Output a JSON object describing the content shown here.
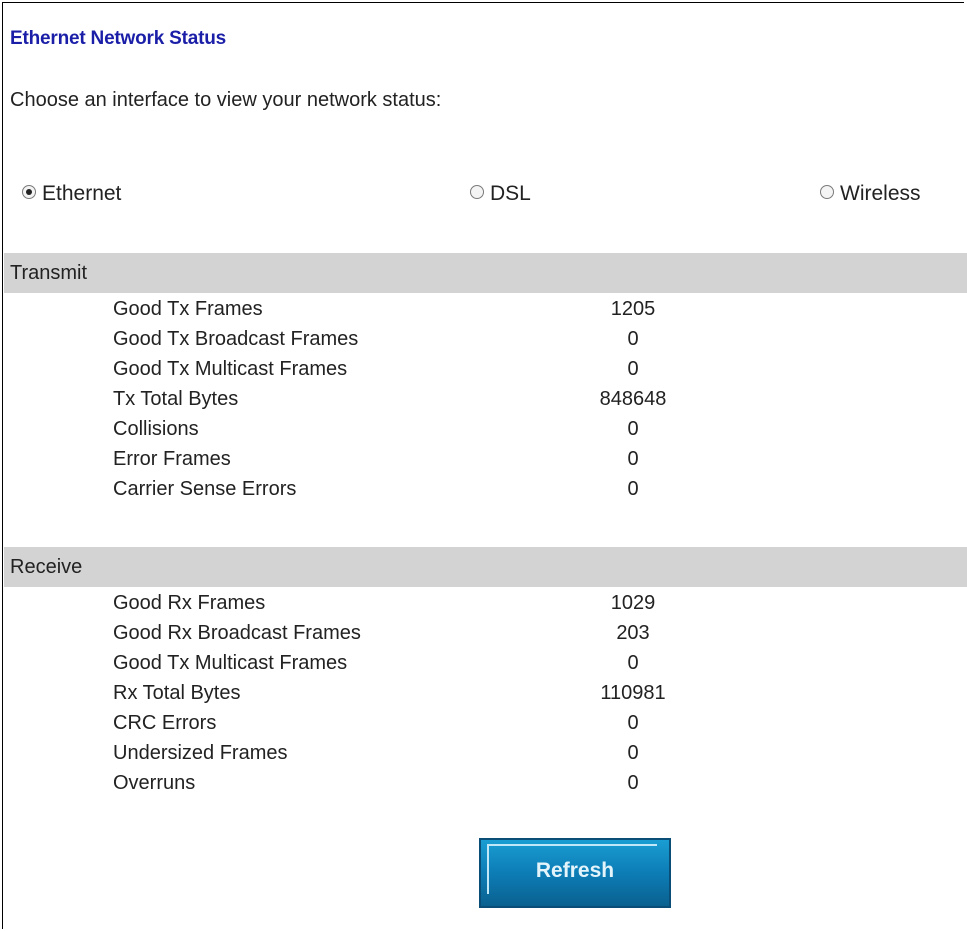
{
  "page": {
    "title": "Ethernet Network Status",
    "instruction": "Choose an interface to view your network status:"
  },
  "interfaces": [
    {
      "label": "Ethernet",
      "selected": true
    },
    {
      "label": "DSL",
      "selected": false
    },
    {
      "label": "Wireless",
      "selected": false
    }
  ],
  "transmit": {
    "heading": "Transmit",
    "rows": [
      {
        "label": "Good Tx Frames",
        "value": "1205"
      },
      {
        "label": "Good Tx Broadcast Frames",
        "value": "0"
      },
      {
        "label": "Good Tx Multicast Frames",
        "value": "0"
      },
      {
        "label": "Tx Total Bytes",
        "value": "848648"
      },
      {
        "label": "Collisions",
        "value": "0"
      },
      {
        "label": "Error Frames",
        "value": "0"
      },
      {
        "label": "Carrier Sense Errors",
        "value": "0"
      }
    ]
  },
  "receive": {
    "heading": "Receive",
    "rows": [
      {
        "label": "Good Rx Frames",
        "value": "1029"
      },
      {
        "label": "Good Rx Broadcast Frames",
        "value": "203"
      },
      {
        "label": "Good Tx Multicast Frames",
        "value": "0"
      },
      {
        "label": "Rx Total Bytes",
        "value": "110981"
      },
      {
        "label": "CRC Errors",
        "value": "0"
      },
      {
        "label": "Undersized Frames",
        "value": "0"
      },
      {
        "label": "Overruns",
        "value": "0"
      }
    ]
  },
  "actions": {
    "refresh_label": "Refresh"
  },
  "colors": {
    "title": "#1b1fa8",
    "section_band": "#d3d3d3",
    "button": "#0d7db6"
  }
}
